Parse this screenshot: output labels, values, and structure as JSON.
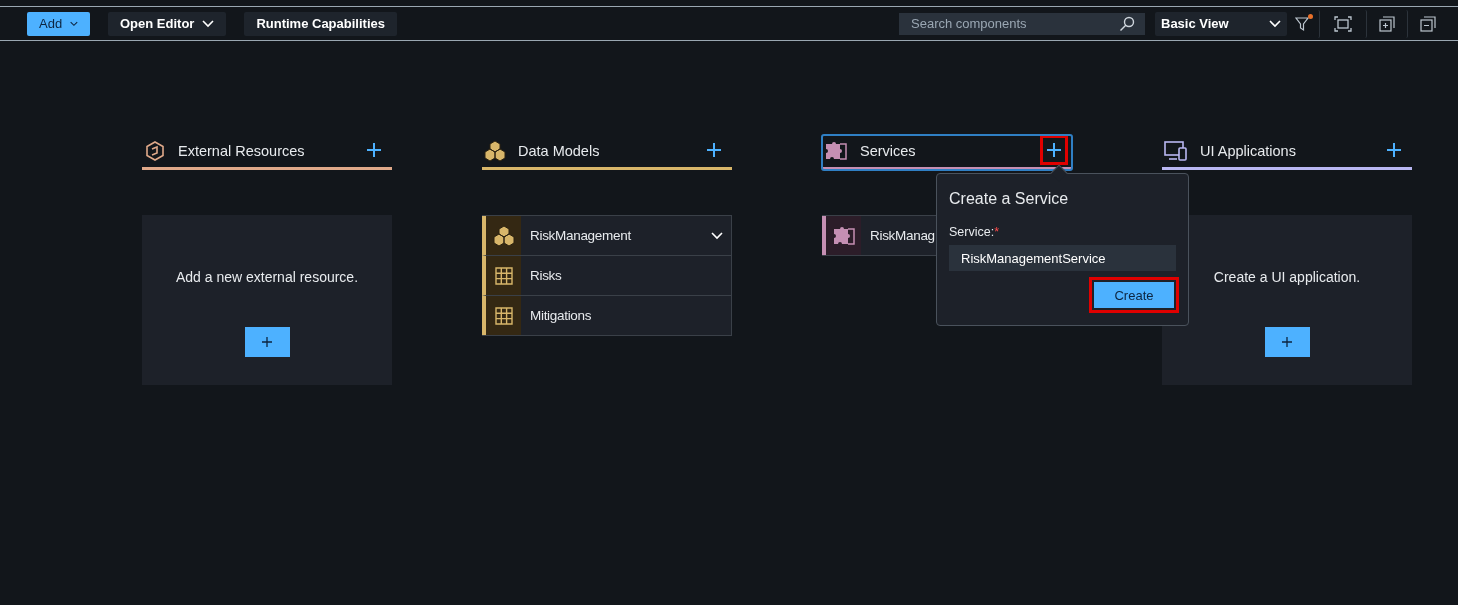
{
  "toolbar": {
    "add_button": "Add",
    "open_editor": "Open Editor",
    "runtime_capabilities": "Runtime Capabilities",
    "search": {
      "placeholder": "Search components"
    },
    "view_select": "Basic View",
    "filter_active": true
  },
  "columns": [
    {
      "kind": "external",
      "title": "External Resources",
      "color": "#e0a98a",
      "focused": false,
      "add_highlighted": false,
      "empty_message": "Add a new external resource."
    },
    {
      "kind": "model",
      "title": "Data Models",
      "color": "#d8b66a",
      "focused": false,
      "add_highlighted": false,
      "items": [
        {
          "kind": "model",
          "label": "RiskManagement",
          "expanded": true,
          "children": [
            {
              "kind": "entity",
              "label": "Risks"
            },
            {
              "kind": "entity",
              "label": "Mitigations"
            }
          ]
        }
      ]
    },
    {
      "kind": "service",
      "title": "Services",
      "color": "#c58fb3",
      "focused": true,
      "add_highlighted": true,
      "items": [
        {
          "kind": "service",
          "label": "RiskManag"
        }
      ],
      "popup": {
        "title": "Create a Service",
        "field_label": "Service:",
        "required_mark": "*",
        "value": "RiskManagementService",
        "button": "Create",
        "button_highlighted": true
      }
    },
    {
      "kind": "ui",
      "title": "UI Applications",
      "color": "#b9b7f2",
      "focused": false,
      "add_highlighted": false,
      "empty_message": "Create a UI application."
    }
  ]
}
